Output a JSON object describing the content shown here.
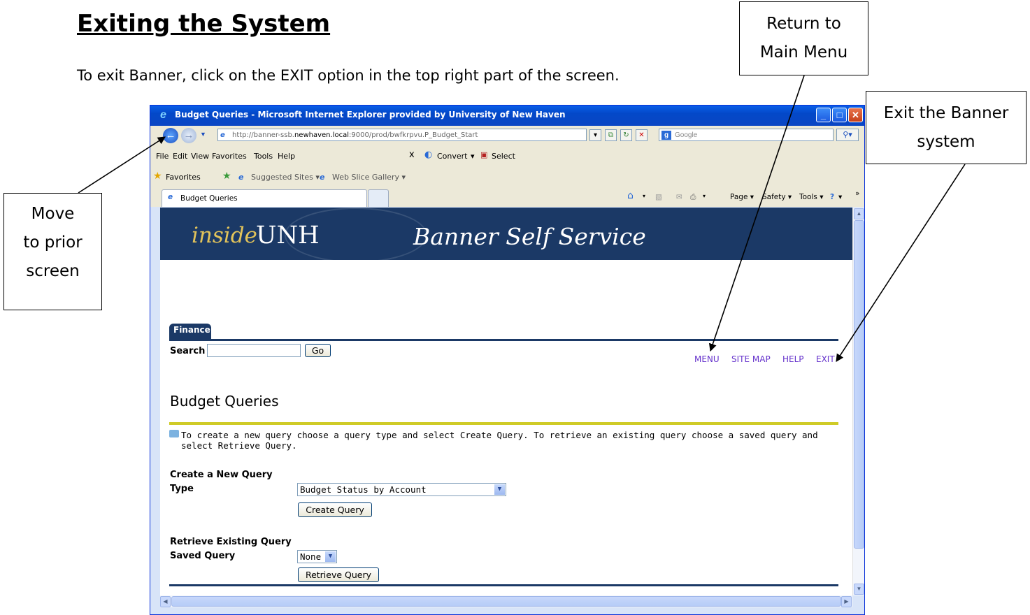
{
  "document": {
    "title": "Exiting the System",
    "intro": "To exit Banner, click on the EXIT option in the top right part of the screen."
  },
  "callouts": {
    "prior_screen": [
      "Move",
      "to prior",
      "screen"
    ],
    "main_menu": [
      "Return to",
      "Main Menu"
    ],
    "exit_banner": [
      "Exit the Banner",
      "system"
    ]
  },
  "browser": {
    "window_title": "Budget Queries - Microsoft Internet Explorer provided by University of New Haven",
    "address_prefix": "http://banner-ssb.",
    "address_host": "newhaven.local",
    "address_suffix": ":9000/prod/bwfkrpvu.P_Budget_Start",
    "search_placeholder": "Google",
    "menu": [
      "File",
      "Edit",
      "View",
      "Favorites",
      "Tools",
      "Help"
    ],
    "toolbar_close": "x",
    "convert_label": "Convert",
    "select_label": "Select",
    "favorites_label": "Favorites",
    "suggested_sites": "Suggested Sites ▾",
    "web_slice": "Web Slice Gallery ▾",
    "tab_label": "Budget Queries",
    "command_bar": {
      "page": "Page ▾",
      "safety": "Safety ▾",
      "tools": "Tools ▾",
      "help": "▾",
      "more": "»"
    }
  },
  "page": {
    "banner_inside": "inside",
    "banner_unh": "UNH",
    "banner_title": "Banner Self Service",
    "tab_finance": "Finance",
    "search_label": "Search",
    "go_button": "Go",
    "top_links": [
      "MENU",
      "SITE MAP",
      "HELP",
      "EXIT"
    ],
    "heading": "Budget Queries",
    "info_text": "To create a new query choose a query type and select Create Query. To retrieve an existing query choose a saved query and select Retrieve Query.",
    "create_section": "Create a New Query",
    "type_label": "Type",
    "type_value": "Budget Status by Account",
    "create_button": "Create Query",
    "retrieve_section": "Retrieve Existing Query",
    "saved_label": "Saved Query",
    "saved_value": "None",
    "retrieve_button": "Retrieve Query"
  },
  "colors": {
    "banner_navy": "#1b3966",
    "rule_yellow": "#cfcb27",
    "link_purple": "#6633cc"
  }
}
